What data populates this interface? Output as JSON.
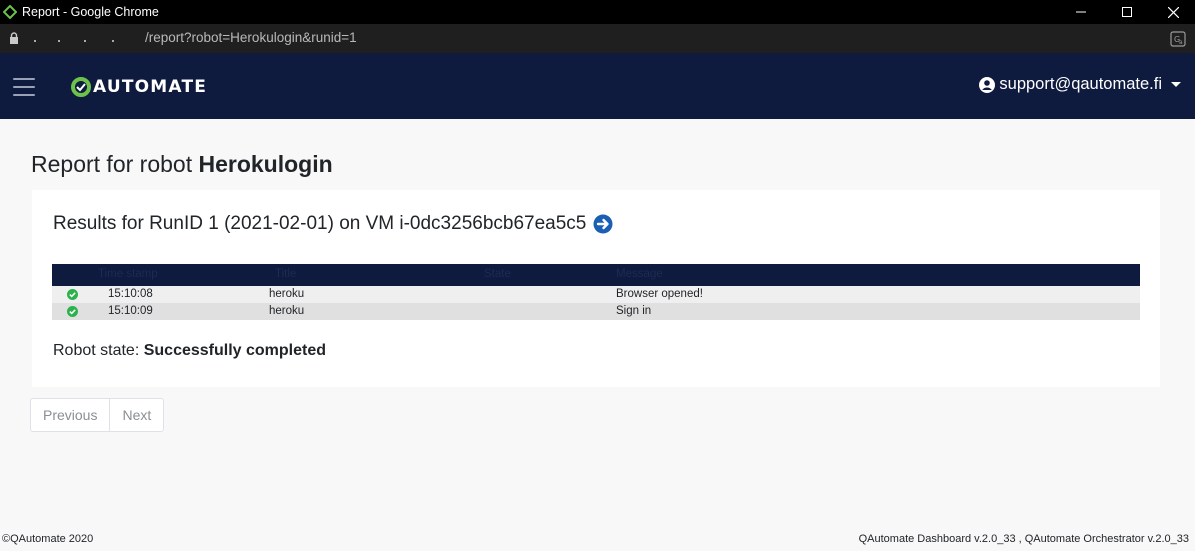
{
  "browser": {
    "window_title": "Report - Google Chrome",
    "url": "/report?robot=Herokulogin&runid=1",
    "controls": {
      "minimize": "—",
      "maximize": "☐",
      "close": "✕"
    }
  },
  "navbar": {
    "logo_text": "AUTOMATE",
    "user_email": "support@qautomate.fi",
    "brand_color": "#0e1a3e",
    "logo_accent": "#6cc24a"
  },
  "report": {
    "title_prefix": "Report for robot",
    "robot_name": "Herokulogin",
    "results_heading": "Results for RunID 1 (2021-02-01) on VM i-0dc3256bcb67ea5c5",
    "table": {
      "columns": [
        "Time stamp",
        "Title",
        "State",
        "Message"
      ],
      "rows": [
        {
          "status_icon": "check-circle-icon",
          "time": "15:10:08",
          "title": "heroku",
          "state": "",
          "message": "Browser opened!"
        },
        {
          "status_icon": "check-circle-icon",
          "time": "15:10:09",
          "title": "heroku",
          "state": "",
          "message": "Sign in"
        }
      ]
    },
    "robot_state_label": "Robot state:",
    "robot_state_value": "Successfully completed"
  },
  "pagination": {
    "previous": "Previous",
    "next": "Next"
  },
  "footer": {
    "copyright": "©QAutomate 2020",
    "versions": "QAutomate Dashboard v.2.0_33 , QAutomate Orchestrator v.2.0_33"
  }
}
